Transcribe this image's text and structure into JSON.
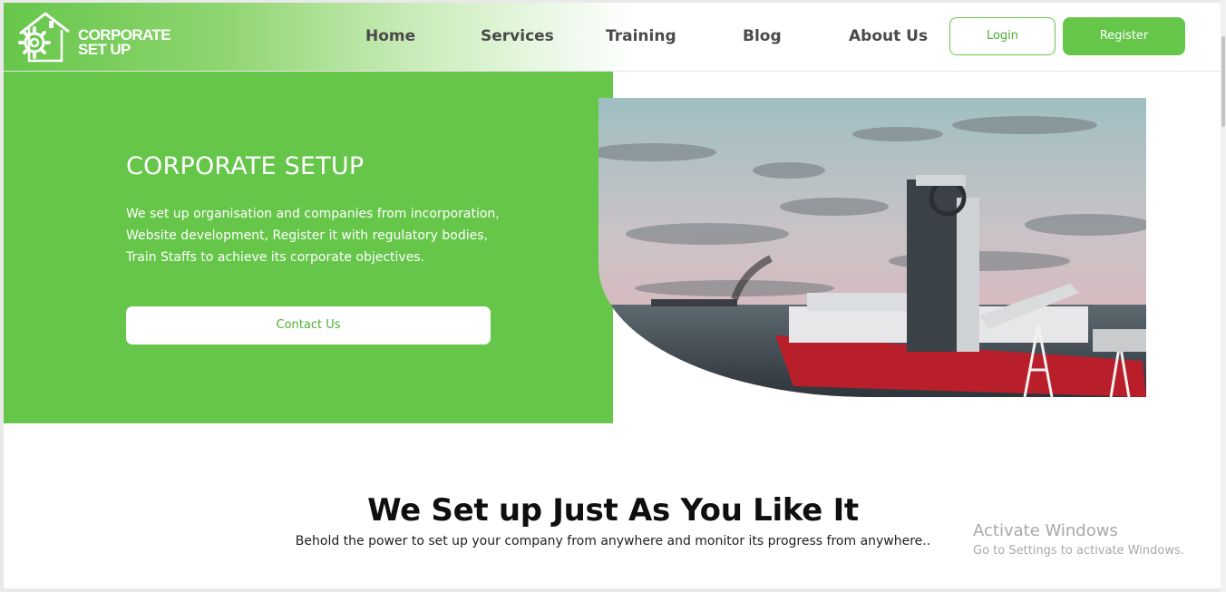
{
  "brand": {
    "line1": "CORPORATE",
    "line2": "SET UP"
  },
  "nav": {
    "items": [
      {
        "label": "Home"
      },
      {
        "label": "Services"
      },
      {
        "label": "Training"
      },
      {
        "label": "Blog"
      },
      {
        "label": "About Us"
      }
    ],
    "login_label": "Login",
    "register_label": "Register"
  },
  "hero": {
    "title": "CORPORATE SETUP",
    "description": "We set up organisation and companies from incorporation, Website development, Register it with regulatory bodies, Train Staffs to achieve its corporate objectives.",
    "cta_label": "Contact Us",
    "image_icon": "offshore-vessel-photo"
  },
  "section": {
    "title": "We Set up Just As You Like It",
    "subtitle": "Behold the power to set up your company from anywhere and monitor its progress from anywhere.."
  },
  "watermark": {
    "line1": "Activate Windows",
    "line2": "Go to Settings to activate Windows."
  },
  "colors": {
    "accent": "#66c64a",
    "accent_dark": "#4cae33",
    "nav_text": "#4a4a4a",
    "heading": "#0f0f0f"
  }
}
